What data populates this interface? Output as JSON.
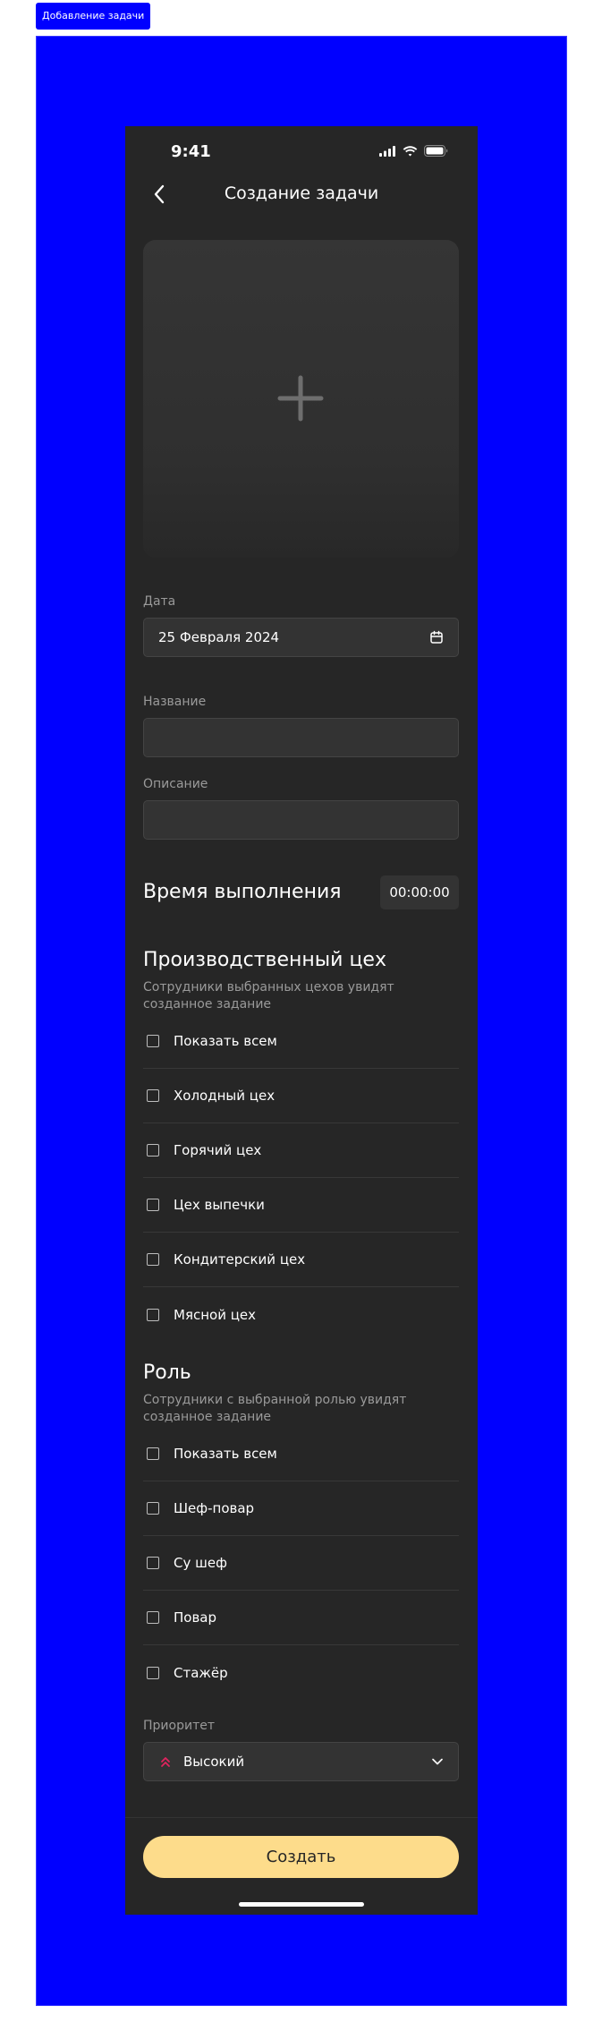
{
  "tag": {
    "label": "Добавление задачи"
  },
  "status": {
    "time": "9:41"
  },
  "nav": {
    "title": "Создание задачи"
  },
  "date": {
    "label": "Дата",
    "value": "25 Февраля 2024"
  },
  "name": {
    "label": "Название",
    "value": ""
  },
  "description": {
    "label": "Описание",
    "value": ""
  },
  "duration": {
    "title": "Время выполнения",
    "value": "00:00:00"
  },
  "workshops": {
    "title": "Производственный цех",
    "subtitle": "Сотрудники выбранных цехов увидят созданное задание",
    "items": [
      {
        "label": "Показать всем",
        "checked": false
      },
      {
        "label": "Холодный цех",
        "checked": false
      },
      {
        "label": "Горячий цех",
        "checked": false
      },
      {
        "label": "Цех выпечки",
        "checked": false
      },
      {
        "label": "Кондитерский цех",
        "checked": false
      },
      {
        "label": "Мясной цех",
        "checked": false
      }
    ]
  },
  "roles": {
    "title": "Роль",
    "subtitle": "Сотрудники с выбранной ролью увидят созданное задание",
    "items": [
      {
        "label": "Показать всем",
        "checked": false
      },
      {
        "label": "Шеф-повар",
        "checked": false
      },
      {
        "label": "Су шеф",
        "checked": false
      },
      {
        "label": "Повар",
        "checked": false
      },
      {
        "label": "Стажёр",
        "checked": false
      }
    ]
  },
  "priority": {
    "label": "Приоритет",
    "value": "Высокий",
    "icon": "chevrons-up-icon",
    "color": "#e0245e"
  },
  "actions": {
    "create_label": "Создать"
  },
  "colors": {
    "canvas": "#0000ff",
    "surface": "#262626",
    "field": "#333333",
    "accent": "#fddc8b"
  }
}
